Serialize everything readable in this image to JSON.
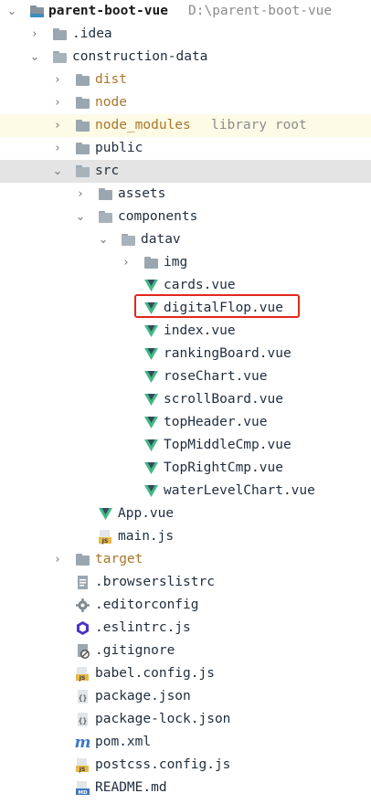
{
  "tree": {
    "root": {
      "name": "parent-boot-vue",
      "path": "D:\\parent-boot-vue"
    },
    "idea": ".idea",
    "construction_data": "construction-data",
    "dist": "dist",
    "node": "node",
    "node_modules": {
      "name": "node_modules",
      "hint": "library root"
    },
    "public": "public",
    "src": "src",
    "assets": "assets",
    "components": "components",
    "datav": "datav",
    "img": "img",
    "vue_files": [
      "cards.vue",
      "digitalFlop.vue",
      "index.vue",
      "rankingBoard.vue",
      "roseChart.vue",
      "scrollBoard.vue",
      "topHeader.vue",
      "TopMiddleCmp.vue",
      "TopRightCmp.vue",
      "waterLevelChart.vue"
    ],
    "app_vue": "App.vue",
    "main_js": "main.js",
    "target": "target",
    "root_files": [
      ".browserslistrc",
      ".editorconfig",
      ".eslintrc.js",
      ".gitignore",
      "babel.config.js",
      "package.json",
      "package-lock.json",
      "pom.xml",
      "postcss.config.js",
      "README.md"
    ]
  },
  "icon_glyphs": {
    "js": "JS",
    "md": "MD",
    "maven": "m",
    "json": "{}"
  },
  "colors": {
    "vue_green": "#41b883",
    "vue_dark": "#35495e",
    "js_yellow": "#e8b84a",
    "excluded_brown": "#a9762b",
    "highlight_red": "#e4261c",
    "selection_gray": "#e4e4e4",
    "library_row": "#fdfbe6"
  }
}
